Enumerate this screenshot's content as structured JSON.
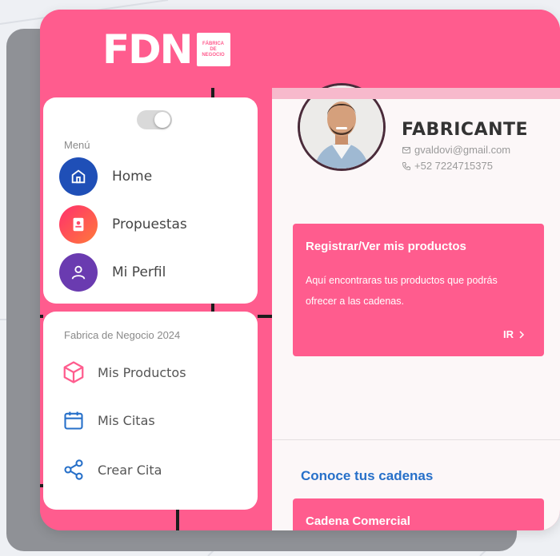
{
  "brand": {
    "logo_text": "FDN",
    "logo_badge": "FÁBRICA DE NEGOCIO",
    "primary_color": "#ff5c8e"
  },
  "sidebar": {
    "section_menu": "Menú",
    "toggle_state": "on",
    "items": [
      {
        "label": "Home",
        "icon": "home-icon",
        "color": "#1f4fb7"
      },
      {
        "label": "Propuestas",
        "icon": "notebook-icon",
        "color": "#ff3f78"
      },
      {
        "label": "Mi Perfil",
        "icon": "user-icon",
        "color": "#6a3bb0"
      }
    ],
    "section_fdn": "Fabrica de Negocio 2024",
    "items2": [
      {
        "label": "Mis Productos",
        "icon": "box-icon",
        "color": "#ff5c8e"
      },
      {
        "label": "Mis Citas",
        "icon": "calendar-icon",
        "color": "#2770c9"
      },
      {
        "label": "Crear Cita",
        "icon": "share-icon",
        "color": "#2770c9"
      }
    ]
  },
  "profile": {
    "role": "FABRICANTE",
    "email": "gvaldovi@gmail.com",
    "phone": "+52 7224715375"
  },
  "promo": {
    "title": "Registrar/Ver mis productos",
    "description": "Aquí encontraras tus productos que podrás ofrecer a las cadenas.",
    "link": "IR"
  },
  "cadenas": {
    "title": "Conoce tus cadenas",
    "first_card": "Cadena Comercial"
  }
}
